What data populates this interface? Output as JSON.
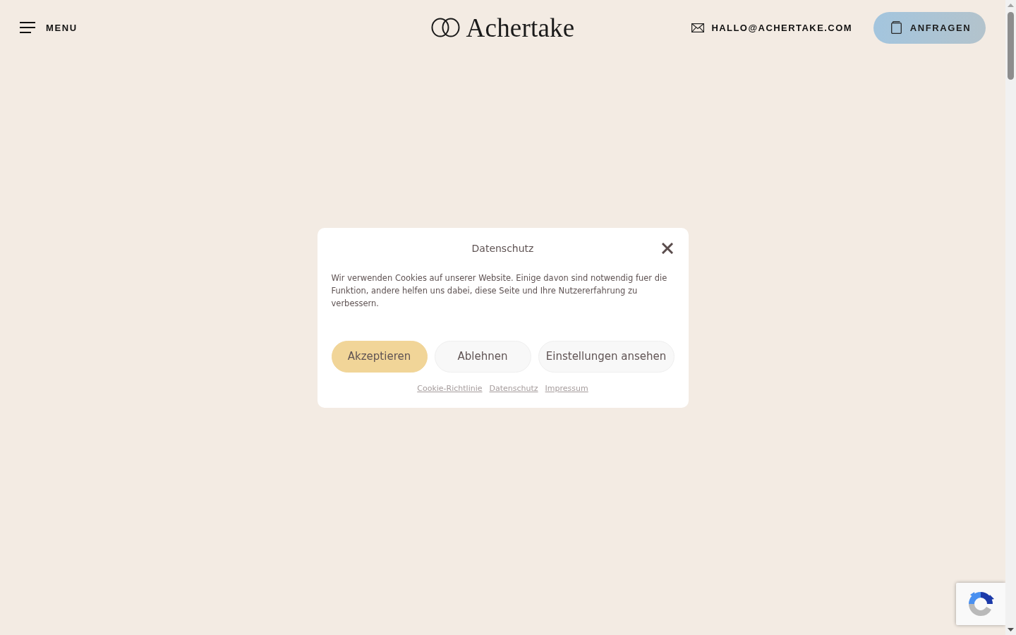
{
  "header": {
    "menu": {
      "label": "MENU"
    },
    "logo": {
      "text": "Achertake"
    },
    "email": {
      "label": "HALLO@ACHERTAKE.COM"
    },
    "cta": {
      "label": "ANFRAGEN"
    }
  },
  "consent_dialog": {
    "title": "Datenschutz",
    "message": "Wir verwenden Cookies auf unserer Website. Einige davon sind notwendig fuer die Funktion, andere helfen uns dabei, diese Seite und Ihre Nutzererfahrung zu verbessern.",
    "buttons": [
      {
        "label": "Akzeptieren",
        "kind": "primary"
      },
      {
        "label": "Ablehnen",
        "kind": "secondary"
      },
      {
        "label": "Einstellungen ansehen",
        "kind": "secondary"
      }
    ],
    "links": [
      "Cookie-Richtlinie",
      "Datenschutz",
      "Impressum"
    ]
  }
}
